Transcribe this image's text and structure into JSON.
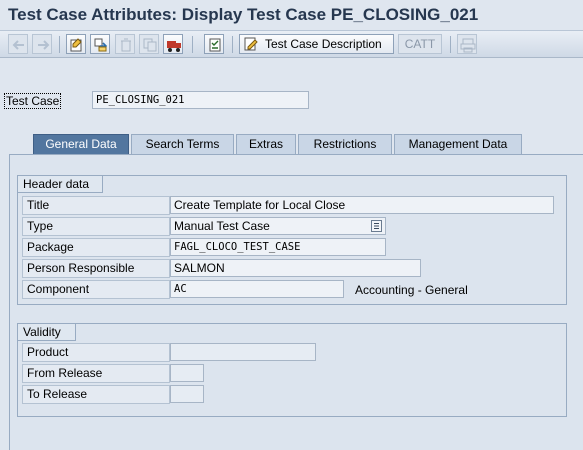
{
  "window": {
    "title": "Test Case Attributes: Display Test Case PE_CLOSING_021"
  },
  "toolbar": {
    "icons": [
      "back-arrow-icon",
      "forward-arrow-icon",
      "display-change-icon",
      "other-object-icon",
      "delete-icon",
      "copy-icon",
      "transport-icon",
      "checklist-icon",
      "edit-document-icon",
      "print-icon"
    ],
    "description_button": "Test Case Description",
    "catt_button": "CATT"
  },
  "header": {
    "test_case_label": "Test Case",
    "test_case_value": "PE_CLOSING_021"
  },
  "tabs": [
    {
      "label": "General Data",
      "active": true
    },
    {
      "label": "Search Terms",
      "active": false
    },
    {
      "label": "Extras",
      "active": false
    },
    {
      "label": "Restrictions",
      "active": false
    },
    {
      "label": "Management Data",
      "active": false
    }
  ],
  "header_data": {
    "title": "Header data",
    "rows": [
      {
        "label": "Title",
        "value": "Create Template for Local Close"
      },
      {
        "label": "Type",
        "value": "Manual Test Case"
      },
      {
        "label": "Package",
        "value": "FAGL_CLOCO_TEST_CASE"
      },
      {
        "label": "Person Responsible",
        "value": "SALMON"
      },
      {
        "label": "Component",
        "value": "AC",
        "description": "Accounting - General"
      }
    ]
  },
  "validity": {
    "title": "Validity",
    "rows": [
      {
        "label": "Product",
        "value": ""
      },
      {
        "label": "From Release",
        "value": ""
      },
      {
        "label": "To Release",
        "value": ""
      }
    ]
  },
  "colors": {
    "background": "#dfe6ef",
    "title": "#26374f",
    "active_tab": "#52769f",
    "border": "#98abc2"
  }
}
